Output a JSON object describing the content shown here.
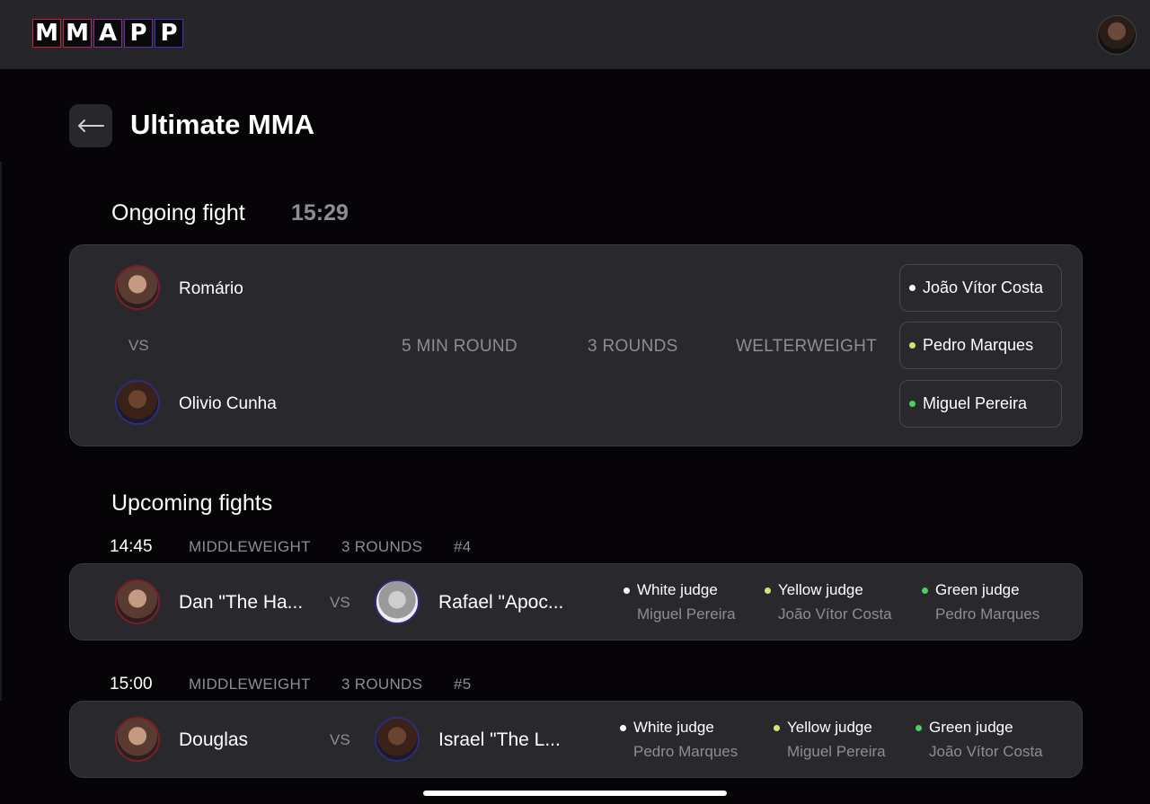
{
  "app": {
    "logo_letters": [
      "M",
      "M",
      "A",
      "P",
      "P"
    ],
    "logo_colors": [
      "#c8262c",
      "#b8265a",
      "#8e2a8e",
      "#6a2ea8",
      "#3a36b8"
    ]
  },
  "header": {
    "title": "Ultimate MMA"
  },
  "ongoing": {
    "section_title": "Ongoing fight",
    "timer": "15:29",
    "fighter1": "Romário",
    "vs": "VS",
    "fighter2": "Olivio Cunha",
    "round_length": "5 MIN ROUND",
    "rounds": "3 ROUNDS",
    "weight_class": "WELTERWEIGHT",
    "judges": [
      {
        "name": "João Vítor Costa",
        "color": "white"
      },
      {
        "name": "Pedro Marques",
        "color": "yellow"
      },
      {
        "name": "Miguel Pereira",
        "color": "green"
      }
    ]
  },
  "upcoming": {
    "section_title": "Upcoming fights",
    "fights": [
      {
        "time": "14:45",
        "weight_class": "MIDDLEWEIGHT",
        "rounds": "3 ROUNDS",
        "number": "#4",
        "fighter1": "Dan \"The Ha...",
        "vs": "VS",
        "fighter2": "Rafael \"Apoc...",
        "judges": [
          {
            "role": "White judge",
            "name": "Miguel Pereira",
            "color": "white"
          },
          {
            "role": "Yellow judge",
            "name": "João Vítor Costa",
            "color": "yellow"
          },
          {
            "role": "Green judge",
            "name": "Pedro Marques",
            "color": "green"
          }
        ]
      },
      {
        "time": "15:00",
        "weight_class": "MIDDLEWEIGHT",
        "rounds": "3 ROUNDS",
        "number": "#5",
        "fighter1": "Douglas",
        "vs": "VS",
        "fighter2": "Israel \"The L...",
        "judges": [
          {
            "role": "White judge",
            "name": "Pedro Marques",
            "color": "white"
          },
          {
            "role": "Yellow judge",
            "name": "Miguel Pereira",
            "color": "yellow"
          },
          {
            "role": "Green judge",
            "name": "João Vítor Costa",
            "color": "green"
          }
        ]
      }
    ]
  },
  "colors": {
    "background": "#060407",
    "card": "#29282d",
    "muted_text": "#8e8d93",
    "judge_white": "#ffffff",
    "judge_yellow": "#d9e07a",
    "judge_green": "#4ccd5e"
  },
  "icons": {
    "back": "arrow-left-icon",
    "user": "user-avatar"
  }
}
